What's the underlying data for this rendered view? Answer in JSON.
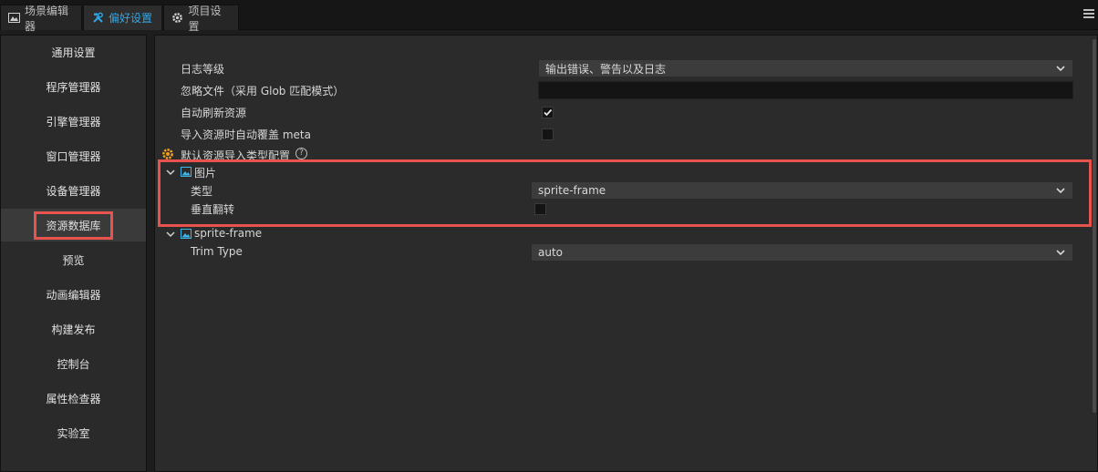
{
  "tabs": [
    {
      "label": "场景编辑器"
    },
    {
      "label": "偏好设置"
    },
    {
      "label": "项目设置"
    }
  ],
  "sidebar": {
    "items": [
      {
        "label": "通用设置"
      },
      {
        "label": "程序管理器"
      },
      {
        "label": "引擎管理器"
      },
      {
        "label": "窗口管理器"
      },
      {
        "label": "设备管理器"
      },
      {
        "label": "资源数据库"
      },
      {
        "label": "预览"
      },
      {
        "label": "动画编辑器"
      },
      {
        "label": "构建发布"
      },
      {
        "label": "控制台"
      },
      {
        "label": "属性检查器"
      },
      {
        "label": "实验室"
      }
    ],
    "active_label": "资源数据库"
  },
  "settings": {
    "log_level_label": "日志等级",
    "log_level_value": "输出错误、警告以及日志",
    "ignore_files_label": "忽略文件（采用 Glob 匹配模式）",
    "ignore_files_value": "",
    "auto_refresh_label": "自动刷新资源",
    "auto_refresh_checked": true,
    "overwrite_meta_label": "导入资源时自动覆盖 meta",
    "overwrite_meta_checked": false,
    "default_import_label": "默认资源导入类型配置",
    "help_glyph": "?"
  },
  "image_group": {
    "label": "图片",
    "type_label": "类型",
    "type_value": "sprite-frame",
    "flip_label": "垂直翻转",
    "flip_checked": false
  },
  "sprite_group": {
    "label": "sprite-frame",
    "trim_label": "Trim Type",
    "trim_value": "auto"
  },
  "colors": {
    "accent": "#2fa7e6",
    "highlight": "#e8534e",
    "gear": "#f0a020"
  },
  "icons": {
    "scene_tab": "scene-editor-icon",
    "prefs_tab": "tools-icon",
    "project_tab": "gear-icon",
    "menu": "hamburger-menu-icon"
  }
}
